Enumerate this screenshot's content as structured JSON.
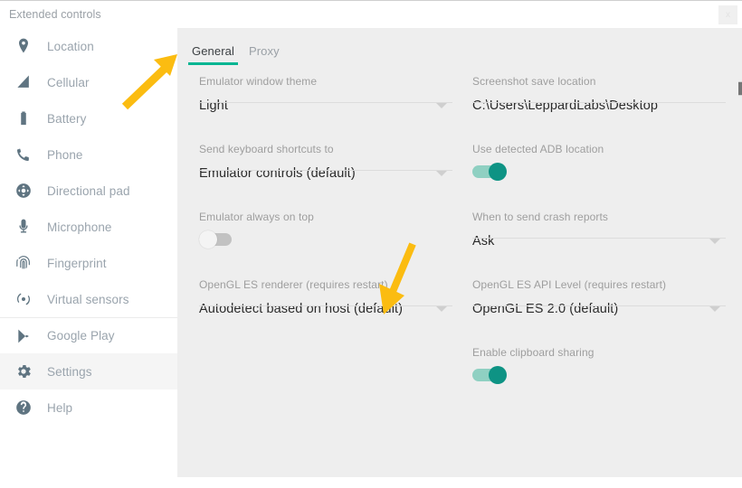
{
  "window": {
    "title": "Extended controls",
    "close_label": "x"
  },
  "sidebar": {
    "items": [
      {
        "label": "Location",
        "icon": "location-pin-icon",
        "selected": false,
        "group_top": false
      },
      {
        "label": "Cellular",
        "icon": "signal-bars-icon",
        "selected": false,
        "group_top": false
      },
      {
        "label": "Battery",
        "icon": "battery-icon",
        "selected": false,
        "group_top": false
      },
      {
        "label": "Phone",
        "icon": "phone-icon",
        "selected": false,
        "group_top": false
      },
      {
        "label": "Directional pad",
        "icon": "dpad-icon",
        "selected": false,
        "group_top": false
      },
      {
        "label": "Microphone",
        "icon": "microphone-icon",
        "selected": false,
        "group_top": false
      },
      {
        "label": "Fingerprint",
        "icon": "fingerprint-icon",
        "selected": false,
        "group_top": false
      },
      {
        "label": "Virtual sensors",
        "icon": "virtual-sensors-icon",
        "selected": false,
        "group_top": false
      },
      {
        "label": "Google Play",
        "icon": "google-play-icon",
        "selected": false,
        "group_top": true
      },
      {
        "label": "Settings",
        "icon": "gear-icon",
        "selected": true,
        "group_top": false
      },
      {
        "label": "Help",
        "icon": "help-circle-icon",
        "selected": false,
        "group_top": false
      }
    ]
  },
  "tabs": [
    {
      "label": "General",
      "active": true
    },
    {
      "label": "Proxy",
      "active": false
    }
  ],
  "settings": {
    "left_column": [
      {
        "label": "Emulator window theme",
        "type": "select",
        "value": "Light"
      },
      {
        "label": "Send keyboard shortcuts to",
        "type": "select",
        "value": "Emulator controls (default)"
      },
      {
        "label": "Emulator always on top",
        "type": "toggle",
        "value": "off"
      },
      {
        "label": "OpenGL ES renderer (requires restart)",
        "type": "select",
        "value": "Autodetect based on host (default)"
      }
    ],
    "right_column": [
      {
        "label": "Screenshot save location",
        "type": "text",
        "value": "C:\\Users\\LeppardLabs\\Desktop",
        "trailing_icon": "folder-icon"
      },
      {
        "label": "Use detected ADB location",
        "type": "toggle",
        "value": "on"
      },
      {
        "label": "When to send crash reports",
        "type": "select",
        "value": "Ask"
      },
      {
        "label": "OpenGL ES API Level (requires restart)",
        "type": "select",
        "value": "OpenGL ES 2.0 (default)"
      },
      {
        "label": "Enable clipboard sharing",
        "type": "toggle",
        "value": "on"
      }
    ]
  },
  "annotations": {
    "arrow_color": "#fbbc11",
    "arrows": [
      {
        "name": "arrow-to-general-tab",
        "points_to": "General tab"
      },
      {
        "name": "arrow-to-opengl-renderer",
        "points_to": "OpenGL ES renderer dropdown"
      }
    ]
  },
  "colors": {
    "accent_teal": "#00b592",
    "toggle_on_knob": "#0e9384",
    "toggle_on_track": "#8fd0c2",
    "panel_bg": "#eeeeee",
    "sidebar_icon": "#5f7481",
    "label_gray": "#9e9e9e"
  }
}
